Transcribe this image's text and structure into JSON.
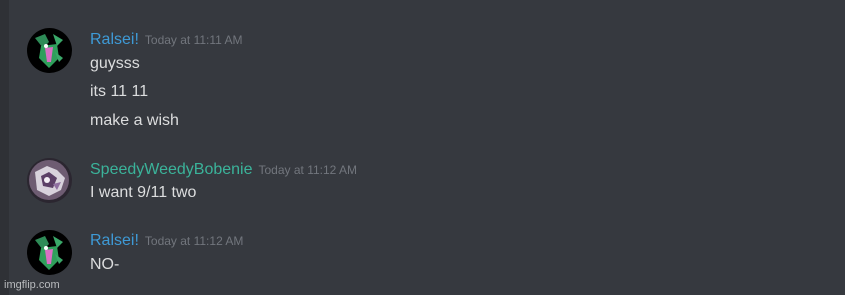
{
  "colors": {
    "background": "#36393f",
    "ralsei_name": "#3e9ad6",
    "speedy_name": "#3bb39a",
    "message_text": "#dcddde",
    "timestamp_text": "#72767d"
  },
  "messages": [
    {
      "username": "Ralsei!",
      "timestamp": "Today at 11:11 AM",
      "avatar_icon": "ralsei-avatar-icon",
      "lines": [
        "guysss",
        "its 11 11",
        "make a wish"
      ]
    },
    {
      "username": "SpeedyWeedyBobenie",
      "timestamp": "Today at 11:12 AM",
      "avatar_icon": "speedy-avatar-icon",
      "lines": [
        "I want 9/11 two"
      ]
    },
    {
      "username": "Ralsei!",
      "timestamp": "Today at 11:12 AM",
      "avatar_icon": "ralsei-avatar-icon",
      "lines": [
        "NO-"
      ]
    }
  ],
  "watermark": "imgflip.com"
}
